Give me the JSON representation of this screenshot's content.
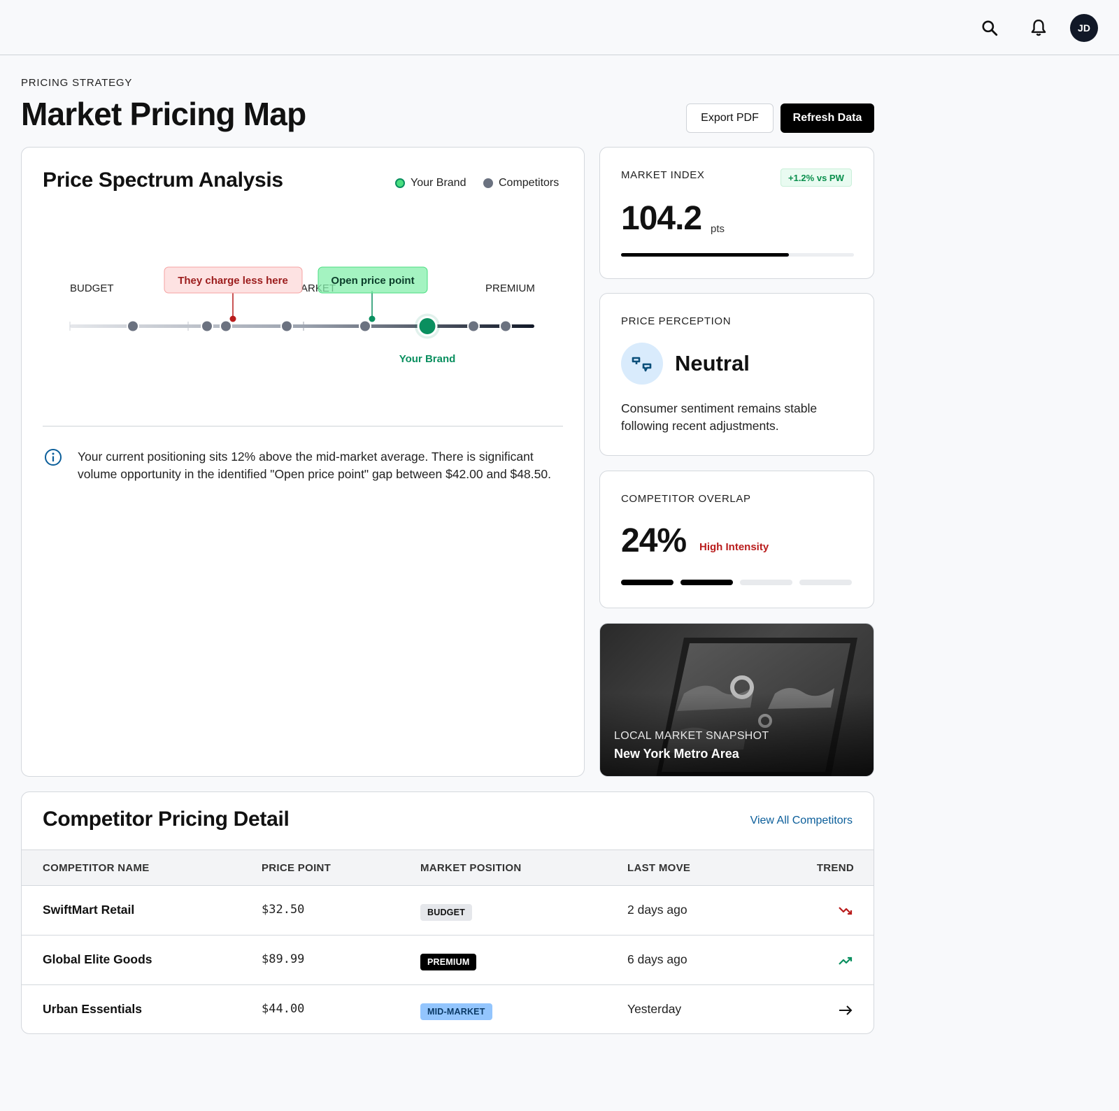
{
  "header": {
    "user_initials": "JD"
  },
  "page": {
    "eyebrow": "PRICING STRATEGY",
    "title": "Market Pricing Map",
    "export_label": "Export PDF",
    "refresh_label": "Refresh Data"
  },
  "spectrum": {
    "title": "Price Spectrum Analysis",
    "legend": {
      "brand": "Your Brand",
      "competitors": "Competitors"
    },
    "scale_labels": {
      "low": "BUDGET",
      "mid": "ARKET",
      "high": "PREMIUM"
    },
    "callouts": {
      "undercut": "They charge less here",
      "gap": "Open price point"
    },
    "brand_label": "Your Brand",
    "insight": "Your current positioning sits 12% above the mid-market average. There is significant volume opportunity in the identified \"Open price point\" gap between $42.00 and $48.50."
  },
  "market_index": {
    "label": "MARKET INDEX",
    "change": "+1.2% vs PW",
    "value": "104.2",
    "unit": "pts",
    "progress_fraction": 0.72
  },
  "perception": {
    "label": "PRICE PERCEPTION",
    "value": "Neutral",
    "description": "Consumer sentiment remains stable following recent adjustments."
  },
  "overlap": {
    "label": "COMPETITOR OVERLAP",
    "value": "24%",
    "intensity": "High Intensity",
    "segments_filled": 2,
    "segments_total": 4
  },
  "snapshot": {
    "label": "LOCAL MARKET SNAPSHOT",
    "title": "New York Metro Area"
  },
  "competitors": {
    "title": "Competitor Pricing Detail",
    "view_all": "View All Competitors",
    "columns": [
      "COMPETITOR NAME",
      "PRICE POINT",
      "MARKET POSITION",
      "LAST MOVE",
      "TREND"
    ],
    "rows": [
      {
        "name": "SwiftMart Retail",
        "price": "$32.50",
        "position": "BUDGET",
        "last_move": "2 days ago",
        "trend": "trending-down"
      },
      {
        "name": "Global Elite Goods",
        "price": "$89.99",
        "position": "PREMIUM",
        "last_move": "6 days ago",
        "trend": "trending-up"
      },
      {
        "name": "Urban Essentials",
        "price": "$44.00",
        "position": "MID-MARKET",
        "last_move": "Yesterday",
        "trend": "flat"
      }
    ]
  },
  "colors": {
    "brand": "#0a8f5f",
    "brand_light": "#4ade80",
    "competitor": "#6b7280",
    "danger": "#b91c1c",
    "link": "#0b5e9a"
  }
}
